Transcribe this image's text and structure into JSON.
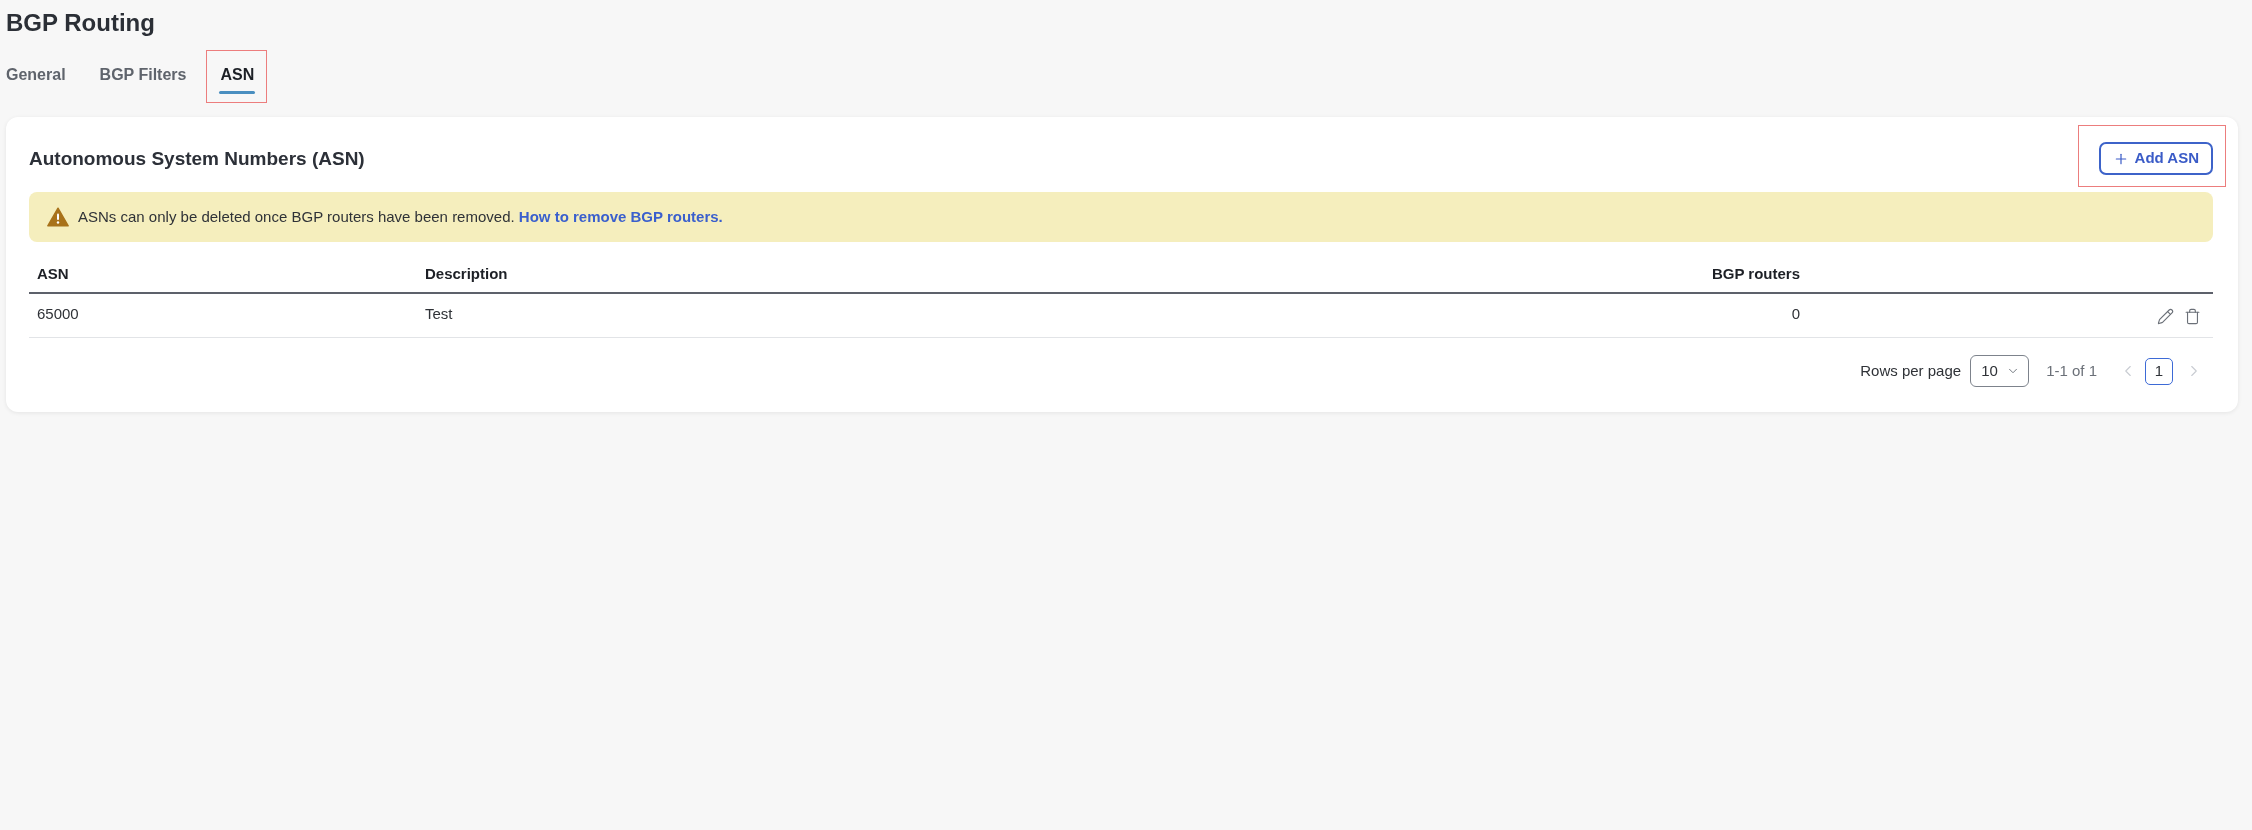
{
  "page": {
    "title": "BGP Routing"
  },
  "tabs": [
    {
      "label": "General",
      "selected": false,
      "highlighted": false
    },
    {
      "label": "BGP Filters",
      "selected": false,
      "highlighted": false
    },
    {
      "label": "ASN",
      "selected": true,
      "highlighted": true
    }
  ],
  "card": {
    "title": "Autonomous System Numbers (ASN)",
    "add_button": {
      "label": "Add ASN",
      "highlighted": true
    },
    "alert": {
      "kind": "warning",
      "text": "ASNs can only be deleted once BGP routers have been removed.",
      "link": "How to remove BGP routers."
    },
    "table": {
      "columns": [
        "ASN",
        "Description",
        "BGP routers"
      ],
      "rows": [
        {
          "cells": [
            "65000",
            "Test",
            "0"
          ]
        }
      ]
    },
    "pagination": {
      "rows_per_page_label": "Rows per page",
      "rows_per_page": "10",
      "range": "1-1 of 1",
      "previous": {
        "disabled": true
      },
      "next": {
        "disabled": true
      },
      "pages": [
        {
          "label": "1",
          "selected": true
        }
      ]
    }
  }
}
